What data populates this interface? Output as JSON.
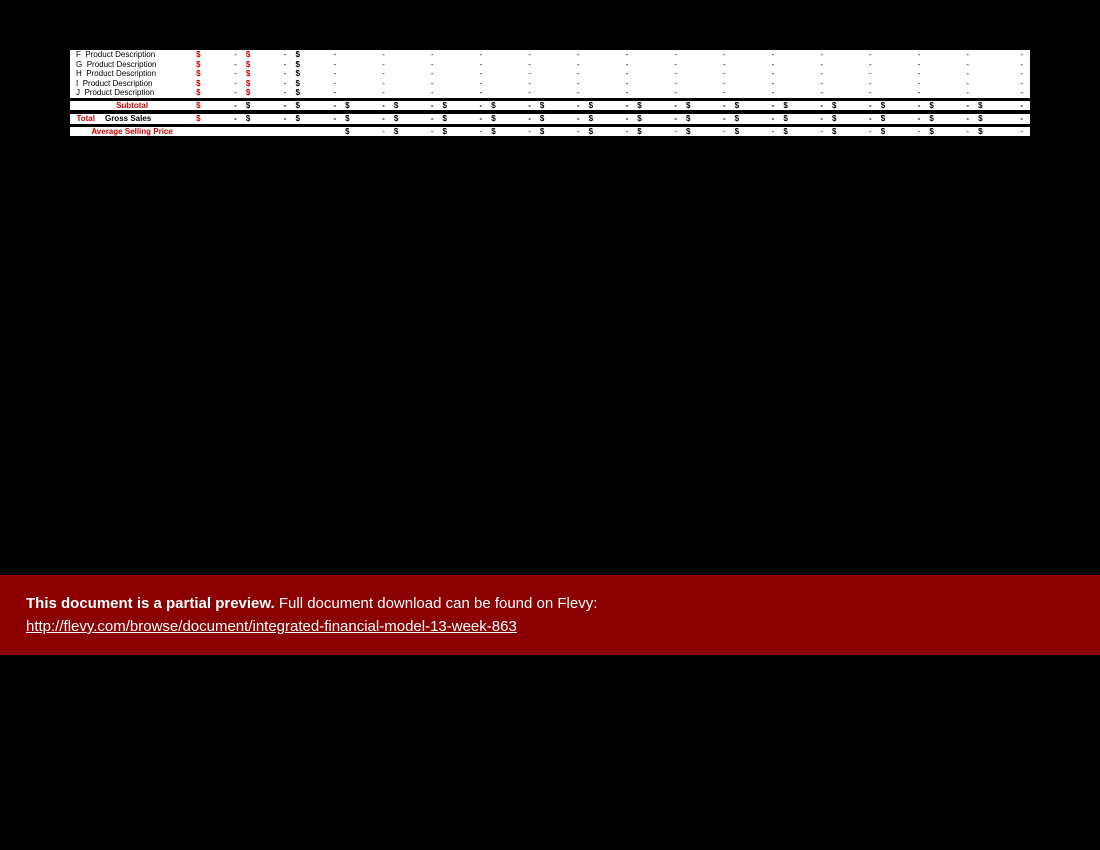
{
  "dash": "-",
  "cur": "$",
  "rows": [
    {
      "letter": "F",
      "desc": "Product Description"
    },
    {
      "letter": "G",
      "desc": "Product Description"
    },
    {
      "letter": "H",
      "desc": "Product Description"
    },
    {
      "letter": "I",
      "desc": "Product Description"
    },
    {
      "letter": "J",
      "desc": "Product Description"
    }
  ],
  "subtotal_label": "Subtotal",
  "total_label_1": "Total",
  "total_label_2": "Gross Sales",
  "avg_label": "Average Selling Price",
  "banner": {
    "line1_bold": "This document is a partial preview.",
    "line1_rest": "  Full document download can be found on Flevy:",
    "link_text": "http://flevy.com/browse/document/integrated-financial-model-13-week-863"
  }
}
